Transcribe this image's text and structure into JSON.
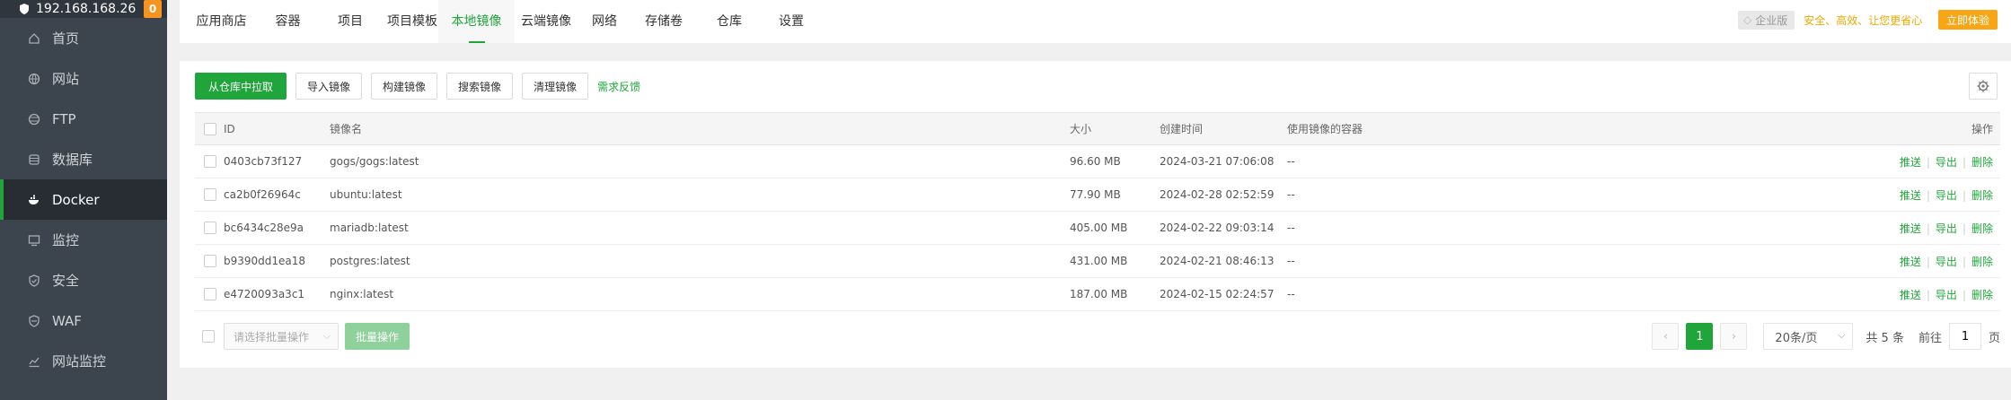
{
  "sidebar": {
    "server_ip": "192.168.168.26",
    "badge": "0",
    "items": [
      {
        "label": "首页",
        "icon": "home-icon"
      },
      {
        "label": "网站",
        "icon": "globe-icon"
      },
      {
        "label": "FTP",
        "icon": "ftp-icon"
      },
      {
        "label": "数据库",
        "icon": "database-icon"
      },
      {
        "label": "Docker",
        "icon": "docker-icon",
        "active": true
      },
      {
        "label": "监控",
        "icon": "monitor-icon"
      },
      {
        "label": "安全",
        "icon": "shield-icon"
      },
      {
        "label": "WAF",
        "icon": "waf-icon"
      },
      {
        "label": "网站监控",
        "icon": "chart-icon"
      }
    ]
  },
  "topbar": {
    "tabs": [
      "应用商店",
      "容器",
      "项目",
      "项目模板",
      "本地镜像",
      "云端镜像",
      "网络",
      "存储卷",
      "仓库",
      "设置"
    ],
    "active_tab": "本地镜像",
    "enterprise_label": "企业版",
    "enterprise_slogan": "安全、高效、让您更省心",
    "try_button": "立即体验"
  },
  "toolbar": {
    "pull_button": "从仓库中拉取",
    "import_button": "导入镜像",
    "build_button": "构建镜像",
    "search_button": "搜索镜像",
    "clean_button": "清理镜像",
    "feedback_link": "需求反馈"
  },
  "table": {
    "headers": {
      "id": "ID",
      "name": "镜像名",
      "size": "大小",
      "created": "创建时间",
      "used_by": "使用镜像的容器",
      "ops": "操作"
    },
    "rows": [
      {
        "id": "0403cb73f127",
        "name": "gogs/gogs:latest",
        "size": "96.60 MB",
        "created": "2024-03-21 07:06:08",
        "used_by": "--"
      },
      {
        "id": "ca2b0f26964c",
        "name": "ubuntu:latest",
        "size": "77.90 MB",
        "created": "2024-02-28 02:52:59",
        "used_by": "--"
      },
      {
        "id": "bc6434c28e9a",
        "name": "mariadb:latest",
        "size": "405.00 MB",
        "created": "2024-02-22 09:03:14",
        "used_by": "--"
      },
      {
        "id": "b9390dd1ea18",
        "name": "postgres:latest",
        "size": "431.00 MB",
        "created": "2024-02-21 08:46:13",
        "used_by": "--"
      },
      {
        "id": "e4720093a3c1",
        "name": "nginx:latest",
        "size": "187.00 MB",
        "created": "2024-02-15 02:24:57",
        "used_by": "--"
      }
    ],
    "op_labels": {
      "push": "推送",
      "export": "导出",
      "delete": "删除"
    }
  },
  "footer": {
    "batch_placeholder": "请选择批量操作",
    "batch_button": "批量操作",
    "current_page": "1",
    "page_size": "20条/页",
    "total": "共 5 条",
    "goto_label": "前往",
    "goto_value": "1",
    "page_unit": "页"
  }
}
